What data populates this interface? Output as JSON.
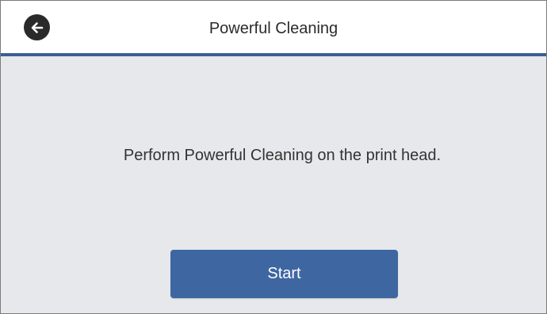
{
  "header": {
    "title": "Powerful Cleaning",
    "back_icon": "arrow-left-icon"
  },
  "main": {
    "message": "Perform Powerful Cleaning on the print head.",
    "start_label": "Start"
  },
  "colors": {
    "accent": "#3e67a2",
    "divider": "#3b5e92",
    "content_background": "#e6e8eb",
    "back_button": "#2a2a2a"
  }
}
